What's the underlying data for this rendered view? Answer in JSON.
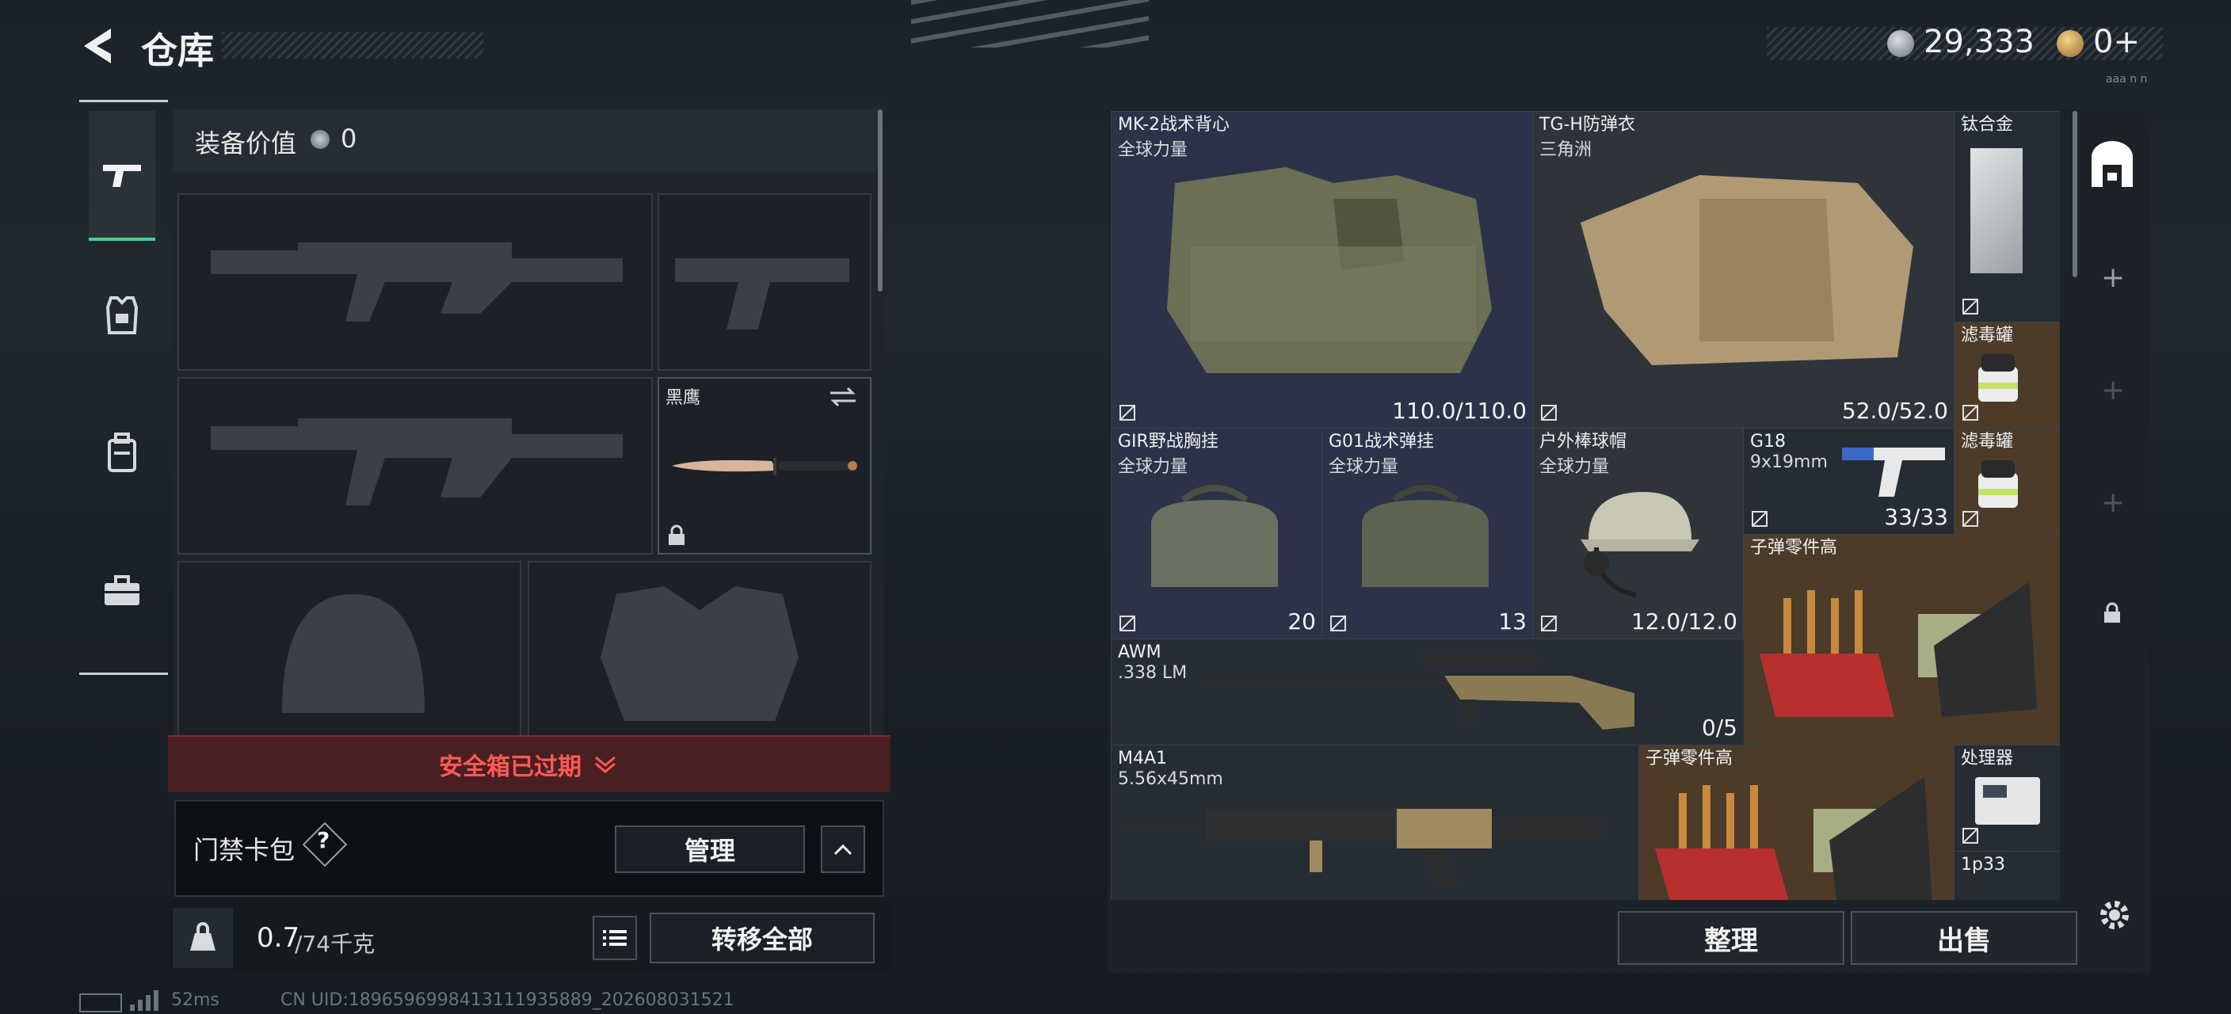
{
  "header": {
    "title": "仓库",
    "currency_main": "29,333",
    "currency_secondary": "0+",
    "tiny_label": "aaa n n"
  },
  "left_tabs": [
    {
      "name": "weapon-tab-icon"
    },
    {
      "name": "armor-tab-icon"
    },
    {
      "name": "backpack-tab-icon"
    },
    {
      "name": "toolbox-tab-icon"
    }
  ],
  "equipment": {
    "value_label": "装备价值",
    "value": "0",
    "melee_name": "黑鹰",
    "safebox_status": "安全箱已过期",
    "card_pack_label": "门禁卡包",
    "card_pack_help": "?",
    "manage_label": "管理",
    "weight_current": "0.7",
    "weight_max": "/74千克",
    "transfer_all": "转移全部"
  },
  "storage": {
    "items": [
      {
        "id": "mk2",
        "name": "MK-2战术背心",
        "sub": "全球力量",
        "value": "110.0/110.0"
      },
      {
        "id": "tgh",
        "name": "TG-H防弹衣",
        "sub": "三角洲",
        "value": "52.0/52.0"
      },
      {
        "id": "ti",
        "name": "钛合金",
        "sub": "",
        "value": ""
      },
      {
        "id": "filter1",
        "name": "滤毒罐",
        "sub": "",
        "value": ""
      },
      {
        "id": "gir",
        "name": "GIR野战胸挂",
        "sub": "全球力量",
        "value": "20"
      },
      {
        "id": "g01",
        "name": "G01战术弹挂",
        "sub": "全球力量",
        "value": "13"
      },
      {
        "id": "cap",
        "name": "户外棒球帽",
        "sub": "全球力量",
        "value": "12.0/12.0"
      },
      {
        "id": "g18",
        "name": "G18",
        "sub": "9x19mm",
        "value": "33/33"
      },
      {
        "id": "filter2",
        "name": "滤毒罐",
        "sub": "",
        "value": ""
      },
      {
        "id": "ammo1",
        "name": "子弹零件高",
        "sub": "",
        "value": ""
      },
      {
        "id": "awm",
        "name": "AWM",
        "sub": ".338 LM",
        "value": "0/5"
      },
      {
        "id": "m4a1",
        "name": "M4A1",
        "sub": "5.56x45mm",
        "value": ""
      },
      {
        "id": "ammo2",
        "name": "子弹零件高",
        "sub": "",
        "value": ""
      },
      {
        "id": "proc",
        "name": "处理器",
        "sub": "",
        "value": ""
      },
      {
        "id": "p33",
        "name": "1p33",
        "sub": "",
        "value": ""
      }
    ],
    "sort_label": "整理",
    "sell_label": "出售"
  },
  "status_bar": {
    "ping": "52ms",
    "uid": "CN UID:1896596998413111935889_202608031521"
  },
  "colors": {
    "accent_green": "#46d38a",
    "warning_red": "#ff5a55",
    "gold_tile": "#4b3b28",
    "blue_tile": "#2c3248"
  }
}
